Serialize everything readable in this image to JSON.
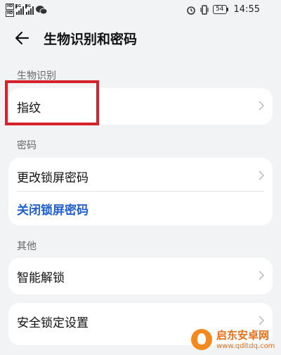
{
  "status_bar": {
    "hd_label": "HD",
    "network_gen_1": "5G",
    "network_gen_2": "4G",
    "battery": "54",
    "time": "14:55"
  },
  "header": {
    "title": "生物识别和密码"
  },
  "sections": {
    "biometric": {
      "label": "生物识别",
      "items": [
        {
          "label": "指纹"
        }
      ]
    },
    "password": {
      "label": "密码",
      "items": [
        {
          "label": "更改锁屏密码"
        },
        {
          "label": "关闭锁屏密码"
        }
      ]
    },
    "other": {
      "label": "其他",
      "items": [
        {
          "label": "智能解锁"
        },
        {
          "label": "安全锁定设置"
        }
      ]
    }
  },
  "colors": {
    "background": "#f1f3f5",
    "card": "#ffffff",
    "link": "#1f5fcf",
    "highlight": "#d6222b",
    "watermark": "#e8701a"
  },
  "watermark": {
    "title": "启东安卓网",
    "url": "www.qdltdq.com"
  }
}
